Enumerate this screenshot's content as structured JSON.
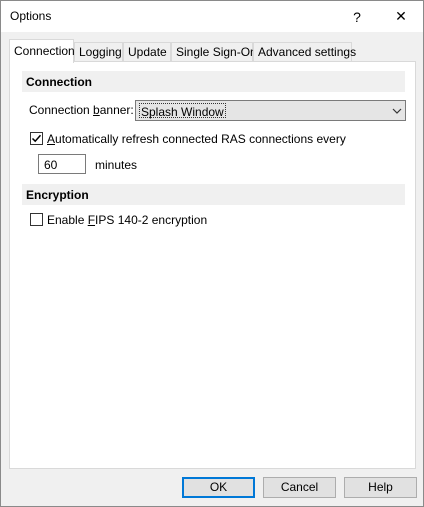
{
  "window": {
    "title": "Options",
    "help_glyph": "?",
    "close_glyph": "✕"
  },
  "tabs": [
    {
      "label": "Connection",
      "active": true
    },
    {
      "label": "Logging",
      "active": false
    },
    {
      "label": "Update",
      "active": false
    },
    {
      "label": "Single Sign-On",
      "active": false
    },
    {
      "label": "Advanced settings",
      "active": false
    }
  ],
  "connection": {
    "header": "Connection",
    "banner_label_pre": "Connection ",
    "banner_label_key": "b",
    "banner_label_post": "anner:",
    "banner_value": "Splash Window",
    "refresh_checked": true,
    "refresh_label_key": "A",
    "refresh_label_rest": "utomatically refresh connected RAS connections every",
    "minutes_value": "60",
    "minutes_label": "minutes"
  },
  "encryption": {
    "header": "Encryption",
    "fips_checked": false,
    "fips_label_pre": "Enable ",
    "fips_label_key": "F",
    "fips_label_post": "IPS 140-2 encryption"
  },
  "buttons": {
    "ok": "OK",
    "cancel": "Cancel",
    "help": "Help"
  },
  "colors": {
    "accent": "#0078d7",
    "section_bg": "#f0f0f0"
  }
}
